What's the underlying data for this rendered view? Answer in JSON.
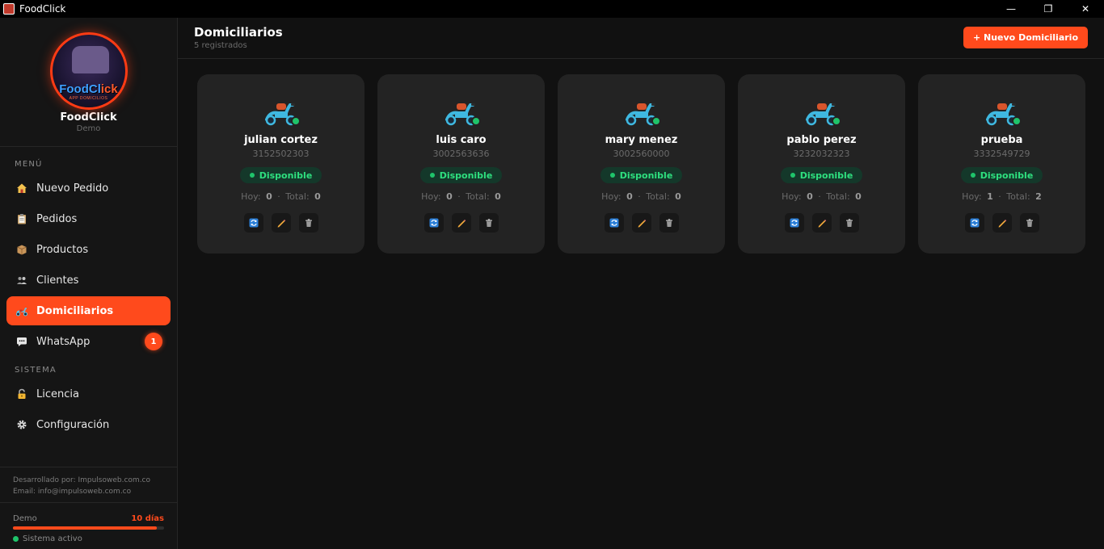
{
  "window": {
    "title": "FoodClick",
    "controls": [
      "—",
      "❐",
      "✕"
    ]
  },
  "sidebar": {
    "brand": {
      "name": "FoodClick",
      "plan": "Demo",
      "logo_text_a": "FoodCl",
      "logo_text_b": "ick",
      "logo_sub": "APP DOMICILIOS"
    },
    "menu_label": "MENÚ",
    "system_label": "SISTEMA",
    "menu_items": [
      {
        "label": "Nuevo Pedido",
        "icon": "house-icon",
        "active": false
      },
      {
        "label": "Pedidos",
        "icon": "clipboard-icon",
        "active": false
      },
      {
        "label": "Productos",
        "icon": "box-icon",
        "active": false
      },
      {
        "label": "Clientes",
        "icon": "users-icon",
        "active": false
      },
      {
        "label": "Domiciliarios",
        "icon": "scooter-icon",
        "active": true
      },
      {
        "label": "WhatsApp",
        "icon": "chat-icon",
        "active": false,
        "badge": "1"
      }
    ],
    "system_items": [
      {
        "label": "Licencia",
        "icon": "lock-icon"
      },
      {
        "label": "Configuración",
        "icon": "gear-icon"
      }
    ],
    "footer": {
      "developed_by": "Desarrollado por: Impulsoweb.com.co",
      "email": "Email: info@impulsoweb.com.co"
    },
    "plan": {
      "label": "Demo",
      "days": "10 días",
      "progress": 0.95,
      "status": "Sistema activo"
    }
  },
  "header": {
    "title": "Domiciliarios",
    "subtitle": "5 registrados",
    "new_button": "+ Nuevo Domiciliario"
  },
  "couriers": [
    {
      "name": "julian cortez",
      "phone": "3152502303",
      "status": "Disponible",
      "hoy_label": "Hoy:",
      "hoy": "0",
      "sep": "·",
      "total_label": "Total:",
      "total": "0"
    },
    {
      "name": "luis caro",
      "phone": "3002563636",
      "status": "Disponible",
      "hoy_label": "Hoy:",
      "hoy": "0",
      "sep": "·",
      "total_label": "Total:",
      "total": "0"
    },
    {
      "name": "mary menez",
      "phone": "3002560000",
      "status": "Disponible",
      "hoy_label": "Hoy:",
      "hoy": "0",
      "sep": "·",
      "total_label": "Total:",
      "total": "0"
    },
    {
      "name": "pablo perez",
      "phone": "3232032323",
      "status": "Disponible",
      "hoy_label": "Hoy:",
      "hoy": "0",
      "sep": "·",
      "total_label": "Total:",
      "total": "0"
    },
    {
      "name": "prueba",
      "phone": "3332549729",
      "status": "Disponible",
      "hoy_label": "Hoy:",
      "hoy": "1",
      "sep": "·",
      "total_label": "Total:",
      "total": "2"
    }
  ],
  "colors": {
    "accent": "#ff4a1c",
    "available": "#1fc46b",
    "card": "#232323",
    "background": "#111111"
  }
}
